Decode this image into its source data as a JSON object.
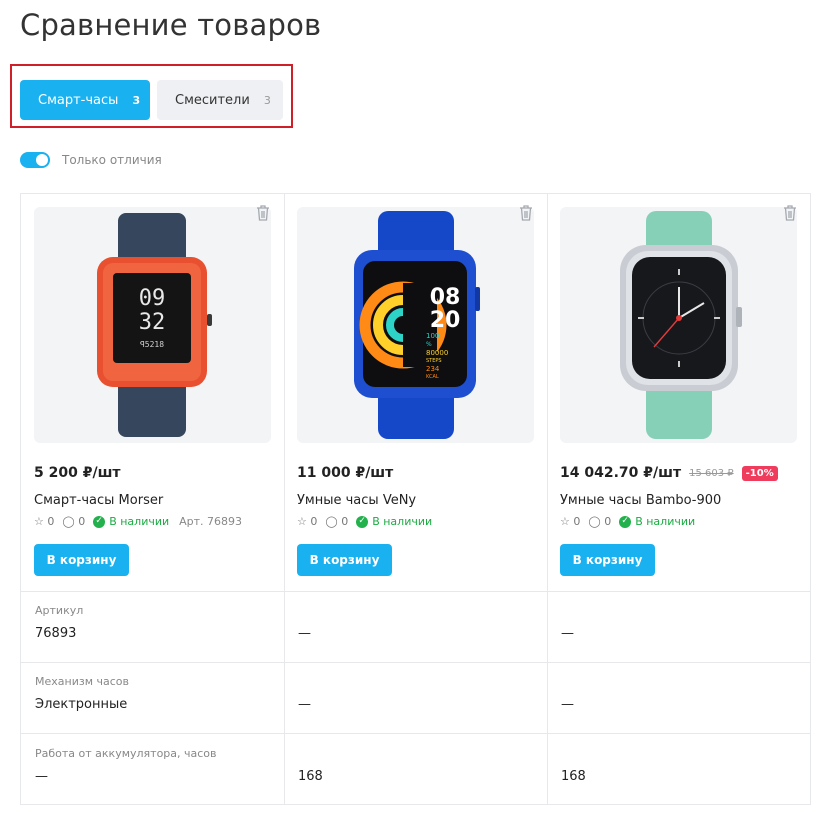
{
  "page": {
    "title": "Сравнение товаров"
  },
  "tabs": [
    {
      "label": "Смарт-часы",
      "count": "3",
      "active": true
    },
    {
      "label": "Смесители",
      "count": "3",
      "active": false
    }
  ],
  "filter": {
    "label": "Только отличия",
    "enabled": true
  },
  "colors": {
    "accent": "#1ab1f0",
    "in_stock": "#22b14c",
    "discount": "#ef3b5c",
    "highlight_frame": "#cf1f28"
  },
  "products": [
    {
      "price": "5 200 ₽/шт",
      "old_price": "",
      "discount": "",
      "name": "Смарт-часы Morser",
      "rating": "0",
      "reviews": "0",
      "stock": "В наличии",
      "article": "Арт. 76893",
      "cart_label": "В корзину",
      "image": "watch-orange"
    },
    {
      "price": "11 000 ₽/шт",
      "old_price": "",
      "discount": "",
      "name": "Умные часы VeNy",
      "rating": "0",
      "reviews": "0",
      "stock": "В наличии",
      "article": "",
      "cart_label": "В корзину",
      "image": "watch-blue"
    },
    {
      "price": "14 042.70 ₽/шт",
      "old_price": "15 603 ₽",
      "discount": "-10%",
      "name": "Умные часы Bambo-900",
      "rating": "0",
      "reviews": "0",
      "stock": "В наличии",
      "article": "",
      "cart_label": "В корзину",
      "image": "watch-mint"
    }
  ],
  "watch_faces": {
    "orange": {
      "hour": "09",
      "minute": "32",
      "sub": "ꟼ5218"
    },
    "blue": {
      "hour": "08",
      "minute": "20",
      "line1": "100",
      "line2": "%",
      "line3": "80000",
      "line4": "STEPS",
      "line5": "234",
      "line6": "KCAL"
    }
  },
  "attributes": [
    {
      "label": "Артикул",
      "values": [
        "76893",
        "—",
        "—"
      ]
    },
    {
      "label": "Механизм часов",
      "values": [
        "Электронные",
        "—",
        "—"
      ]
    },
    {
      "label": "Работа от аккумулятора, часов",
      "values": [
        "—",
        "168",
        "168"
      ]
    }
  ]
}
